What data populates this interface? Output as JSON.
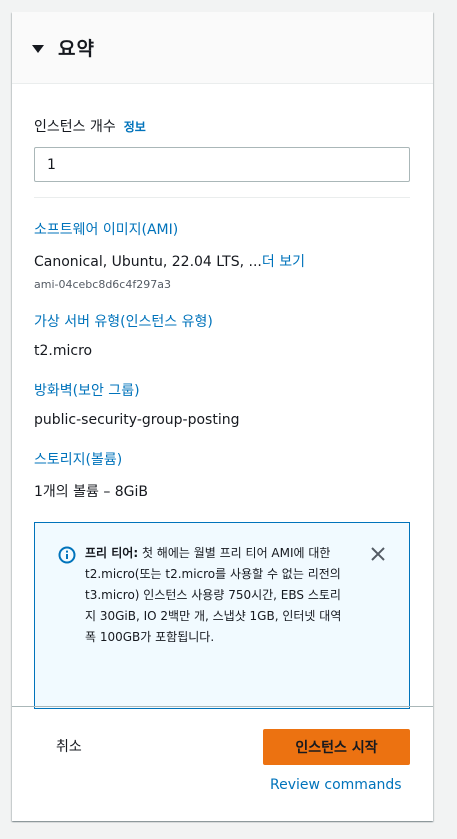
{
  "summary": {
    "title": "요약",
    "instance_count": {
      "label": "인스턴스 개수",
      "info": "정보",
      "value": "1"
    },
    "ami": {
      "title": "소프트웨어 이미지(AMI)",
      "value": "Canonical, Ubuntu, 22.04 LTS, ...",
      "more_link": "더 보기",
      "id": "ami-04cebc8d6c4f297a3"
    },
    "instance_type": {
      "title": "가상 서버 유형(인스턴스 유형)",
      "value": "t2.micro"
    },
    "security_group": {
      "title": "방화벽(보안 그룹)",
      "value": "public-security-group-posting"
    },
    "storage": {
      "title": "스토리지(볼륨)",
      "value": "1개의 볼륨 – 8GiB"
    },
    "free_tier": {
      "bold": "프리 티어:",
      "text": " 첫 해에는 월별 프리 티어 AMI에 대한 t2.micro(또는 t2.micro를 사용할 수 없는 리전의 t3.micro) 인스턴스 사용량 750시간, EBS 스토리지 30GiB, IO 2백만 개, 스냅샷 1GB, 인터넷 대역폭 100GB가 포함됩니다."
    },
    "actions": {
      "cancel": "취소",
      "launch": "인스턴스 시작",
      "review": "Review commands"
    }
  },
  "icons": {
    "header": "caret-down-icon",
    "alert": "info-circle-icon",
    "close": "close-icon"
  },
  "colors": {
    "link": "#0073bb",
    "primary_button": "#ec7211",
    "alert_bg": "#f1faff",
    "alert_border": "#0073bb"
  }
}
